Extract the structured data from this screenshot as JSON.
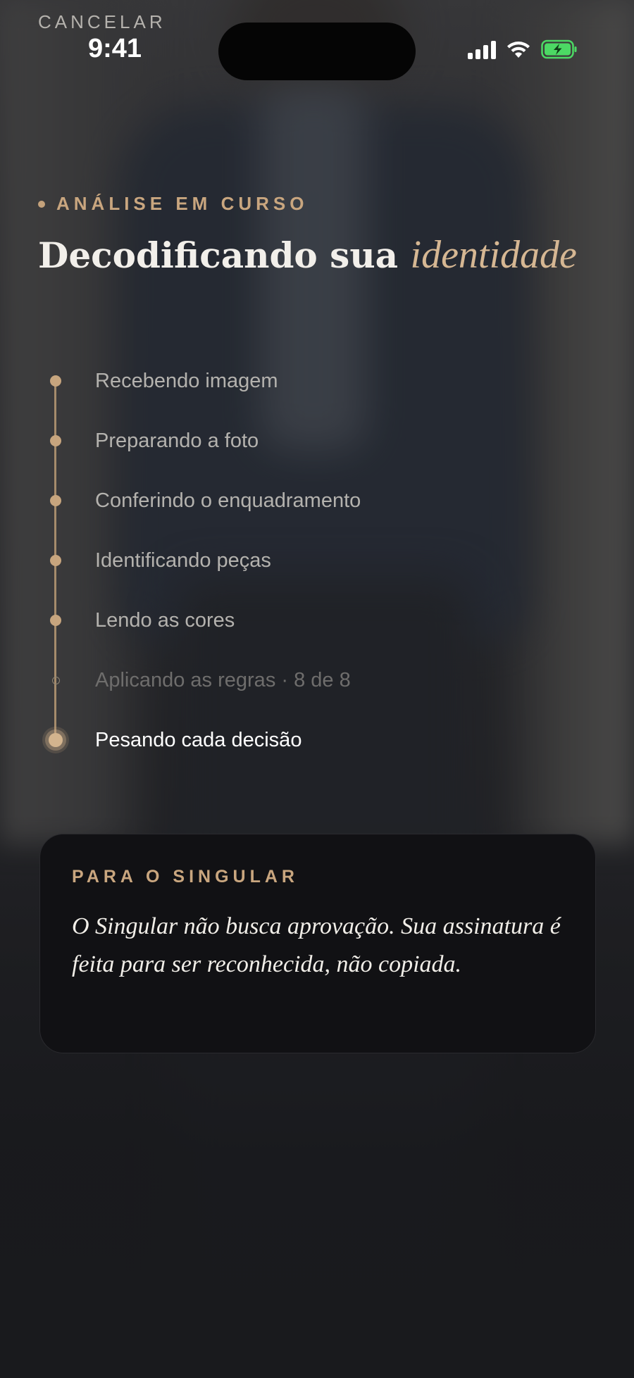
{
  "status_bar": {
    "cancel_label": "CANCELAR",
    "time": "9:41",
    "battery_color": "#4cd964"
  },
  "header": {
    "eyebrow": "ANÁLISE EM CURSO",
    "title_main": "Decodificando sua",
    "title_accent": "identidade"
  },
  "progress": {
    "steps": [
      {
        "label": "Recebendo imagem",
        "state": "done"
      },
      {
        "label": "Preparando a foto",
        "state": "done"
      },
      {
        "label": "Conferindo o enquadramento",
        "state": "done"
      },
      {
        "label": "Identificando peças",
        "state": "done"
      },
      {
        "label": "Lendo as cores",
        "state": "done"
      },
      {
        "label": "Aplicando as regras · 8 de 8",
        "state": "pending"
      },
      {
        "label": "Pesando cada decisão",
        "state": "active"
      }
    ]
  },
  "card": {
    "eyebrow": "PARA O SINGULAR",
    "quote": "O Singular não busca aprovação. Sua assinatura é feita para ser reconhecida, não copiada."
  },
  "colors": {
    "accent": "#c9a67f",
    "card_bg": "#111114"
  }
}
